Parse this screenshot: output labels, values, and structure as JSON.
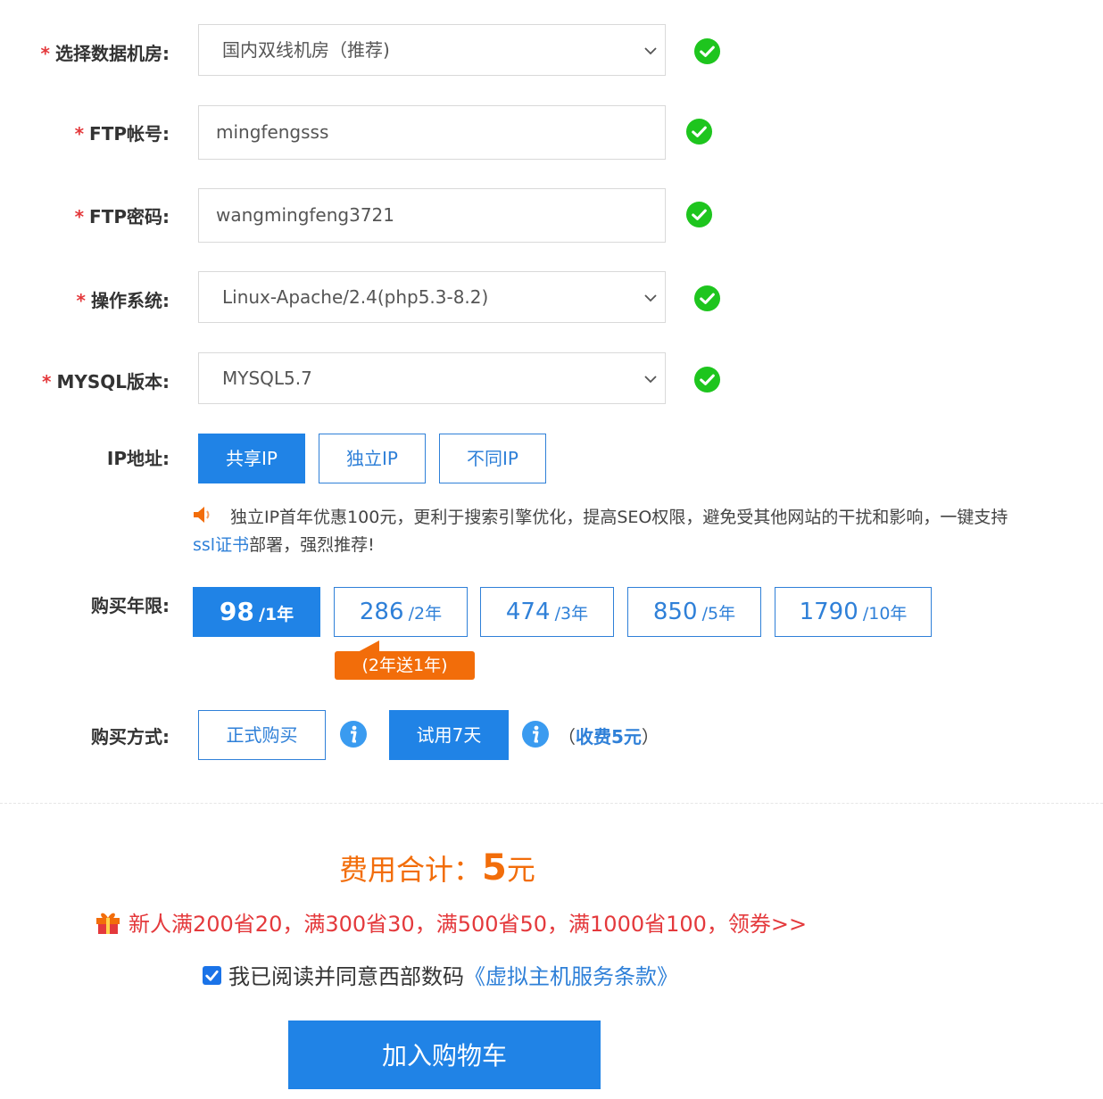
{
  "fields": {
    "datacenter": {
      "label": "选择数据机房:",
      "value": "国内双线机房（推荐)"
    },
    "ftp_account": {
      "label": "FTP帐号:",
      "value": "mingfengsss"
    },
    "ftp_password": {
      "label": "FTP密码:",
      "value": "wangmingfeng3721"
    },
    "os": {
      "label": "操作系统:",
      "value": "Linux-Apache/2.4(php5.3-8.2)"
    },
    "mysql": {
      "label": "MYSQL版本:",
      "value": "MYSQL5.7"
    },
    "required_mark": "*"
  },
  "ip": {
    "label": "IP地址:",
    "options": [
      "共享IP",
      "独立IP",
      "不同IP"
    ],
    "selected": 0,
    "notice": "独立IP首年优惠100元，更利于搜索引擎优化，提高SEO权限，避免受其他网站的干扰和影响，一键支持",
    "notice_link": "ssl证书",
    "notice_tail": "部署，强烈推荐!"
  },
  "years": {
    "label": "购买年限:",
    "options": [
      {
        "price": "98",
        "period": "/1年"
      },
      {
        "price": "286",
        "period": "/2年"
      },
      {
        "price": "474",
        "period": "/3年"
      },
      {
        "price": "850",
        "period": "/5年"
      },
      {
        "price": "1790",
        "period": "/10年"
      }
    ],
    "selected": 0,
    "promo_tag": "(2年送1年)"
  },
  "method": {
    "label": "购买方式:",
    "formal": "正式购买",
    "trial": "试用7天",
    "fee_open": "（",
    "fee": "收费5元",
    "fee_close": "）"
  },
  "total": {
    "label": "费用合计：",
    "amount": "5",
    "unit": "元"
  },
  "promo": "新人满200省20，满300省30，满500省50，满1000省100，领券>>",
  "agree": {
    "text": "我已阅读并同意西部数码",
    "link": "《虚拟主机服务条款》",
    "checked": true
  },
  "cart_button": "加入购物车",
  "colors": {
    "primary": "#2083e6",
    "orange": "#f26d0a",
    "red": "#e4393c",
    "green": "#1ec51e"
  }
}
